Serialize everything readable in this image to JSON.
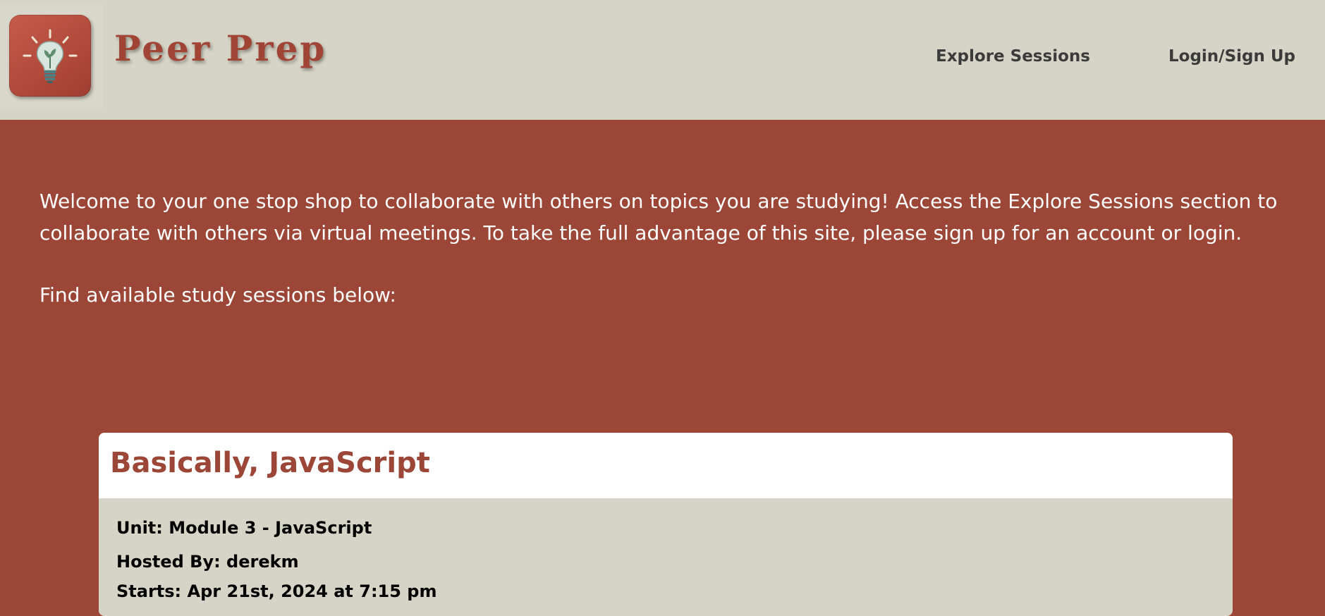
{
  "header": {
    "brand": "Peer Prep",
    "logo_icon": "lightbulb-icon",
    "nav": [
      {
        "label": "Explore Sessions"
      },
      {
        "label": "Login/Sign Up"
      }
    ]
  },
  "main": {
    "intro": "Welcome to your one stop shop to collaborate with others on topics you are studying! Access the Explore Sessions section to collaborate with others via virtual meetings. To take the full advantage of this site, please sign up for an account or login.",
    "find_label": "Find available study sessions below:"
  },
  "sessions": [
    {
      "title": "Basically, JavaScript",
      "unit": "Unit: Module 3 - JavaScript",
      "host": "Hosted By: derekm",
      "starts": "Starts: Apr 21st, 2024 at 7:15 pm"
    }
  ],
  "colors": {
    "brand_red": "#9c4637",
    "header_bg": "#d6d4c6",
    "card_body_bg": "#d6d4c6"
  }
}
